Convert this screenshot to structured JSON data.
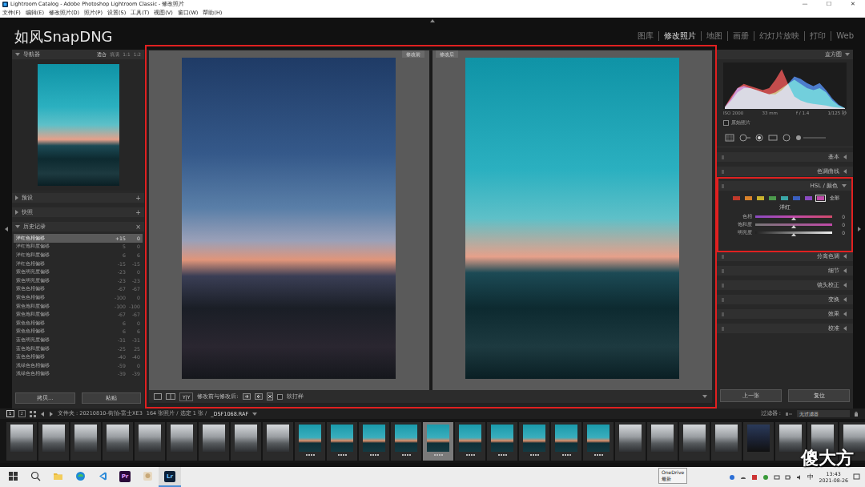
{
  "window": {
    "title": "Lightroom Catalog - Adobe Photoshop Lightroom Classic - 修改照片",
    "controls": [
      "—",
      "☐",
      "✕"
    ]
  },
  "menu": [
    "文件(F)",
    "编辑(E)",
    "修改照片(D)",
    "照片(P)",
    "设置(S)",
    "工具(T)",
    "视图(V)",
    "窗口(W)",
    "帮助(H)"
  ],
  "identity_plate": "如风SnapDNG",
  "modules": [
    {
      "label": "图库",
      "selected": false
    },
    {
      "label": "修改照片",
      "selected": true
    },
    {
      "label": "地图",
      "selected": false
    },
    {
      "label": "画册",
      "selected": false
    },
    {
      "label": "幻灯片放映",
      "selected": false
    },
    {
      "label": "打印",
      "selected": false
    },
    {
      "label": "Web",
      "selected": false
    }
  ],
  "left_panel": {
    "navigator": {
      "title": "导航器",
      "expanded": true,
      "zoom": [
        {
          "label": "适合",
          "selected": true
        },
        {
          "label": "填满",
          "selected": false
        },
        {
          "label": "1:1",
          "selected": false
        },
        {
          "label": "1:2",
          "selected": false
        }
      ]
    },
    "sections": [
      {
        "title": "预设",
        "action": "+",
        "expanded": false
      },
      {
        "title": "快照",
        "action": "+",
        "expanded": false
      },
      {
        "title": "历史记录",
        "action": "×",
        "expanded": true
      }
    ],
    "history": [
      {
        "name": "洋红色相偏移",
        "from": "+15",
        "to": "0",
        "selected": true
      },
      {
        "name": "洋红饱和度偏移",
        "from": "5",
        "to": "0",
        "selected": false
      },
      {
        "name": "洋红饱和度偏移",
        "from": "6",
        "to": "6",
        "selected": false
      },
      {
        "name": "洋红色相偏移",
        "from": "-15",
        "to": "-15",
        "selected": false
      },
      {
        "name": "紫色明亮度偏移",
        "from": "-23",
        "to": "0",
        "selected": false
      },
      {
        "name": "紫色明亮度偏移",
        "from": "-23",
        "to": "-23",
        "selected": false
      },
      {
        "name": "紫色色相偏移",
        "from": "-67",
        "to": "-67",
        "selected": false
      },
      {
        "name": "紫色色相偏移",
        "from": "-100",
        "to": "0",
        "selected": false
      },
      {
        "name": "紫色饱和度偏移",
        "from": "-100",
        "to": "-100",
        "selected": false
      },
      {
        "name": "紫色饱和度偏移",
        "from": "-67",
        "to": "-67",
        "selected": false
      },
      {
        "name": "紫色色相偏移",
        "from": "6",
        "to": "0",
        "selected": false
      },
      {
        "name": "紫色色相偏移",
        "from": "6",
        "to": "6",
        "selected": false
      },
      {
        "name": "蓝色明亮度偏移",
        "from": "-31",
        "to": "-31",
        "selected": false
      },
      {
        "name": "蓝色饱和度偏移",
        "from": "-25",
        "to": "25",
        "selected": false
      },
      {
        "name": "蓝色色相偏移",
        "from": "-40",
        "to": "-40",
        "selected": false
      },
      {
        "name": "浅绿色色相偏移",
        "from": "-59",
        "to": "0",
        "selected": false
      },
      {
        "name": "浅绿色色相偏移",
        "from": "-39",
        "to": "-39",
        "selected": false
      }
    ],
    "buttons": [
      "拷贝...",
      "粘贴"
    ]
  },
  "view": {
    "before": "修改前",
    "after": "修改后",
    "toolbar": {
      "mode": "Y|Y",
      "label": "修改前与修改后:",
      "soft_proof": {
        "label": "软打样",
        "checked": false
      }
    }
  },
  "right_panel": {
    "histogram": {
      "title": "直方图",
      "expanded": true,
      "series": {
        "red": [
          0.05,
          0.3,
          0.5,
          0.6,
          0.55,
          0.5,
          0.45,
          0.5,
          0.7,
          0.95,
          0.6,
          0.3,
          0.2,
          0.15,
          0.12,
          0.1,
          0.08,
          0.05,
          0.03,
          0.02
        ],
        "green": [
          0.04,
          0.2,
          0.4,
          0.5,
          0.5,
          0.45,
          0.4,
          0.35,
          0.4,
          0.5,
          0.6,
          0.7,
          0.6,
          0.5,
          0.45,
          0.5,
          0.4,
          0.2,
          0.08,
          0.02
        ],
        "blue": [
          0.05,
          0.25,
          0.5,
          0.55,
          0.5,
          0.45,
          0.4,
          0.35,
          0.35,
          0.45,
          0.6,
          0.78,
          0.72,
          0.62,
          0.55,
          0.62,
          0.45,
          0.25,
          0.1,
          0.02
        ]
      },
      "info": [
        "ISO 2000",
        "33 mm",
        "f / 1.4",
        "1/125 秒"
      ],
      "original_photo": {
        "label": "原始照片",
        "checked": false
      }
    },
    "sections": [
      {
        "title": "基本",
        "expanded": false
      },
      {
        "title": "色调曲线",
        "expanded": false
      },
      {
        "title": "HSL / 颜色",
        "expanded": true
      },
      {
        "title": "分离色调",
        "expanded": false
      },
      {
        "title": "细节",
        "expanded": false
      },
      {
        "title": "镜头校正",
        "expanded": false
      },
      {
        "title": "变换",
        "expanded": false
      },
      {
        "title": "效果",
        "expanded": false
      },
      {
        "title": "校准",
        "expanded": false
      }
    ],
    "hsl": {
      "swatches": [
        {
          "color": "#c0392b",
          "selected": false
        },
        {
          "color": "#d9822b",
          "selected": false
        },
        {
          "color": "#c9b22e",
          "selected": false
        },
        {
          "color": "#4c9a4c",
          "selected": false
        },
        {
          "color": "#3aa6a6",
          "selected": false
        },
        {
          "color": "#3a5fc0",
          "selected": false
        },
        {
          "color": "#8a4ac0",
          "selected": false
        },
        {
          "color": "#c04aa8",
          "selected": true
        }
      ],
      "all": "全部",
      "current": "洋红",
      "sliders": [
        {
          "label": "色相",
          "value": "0",
          "level": 0.5,
          "kind": "hue"
        },
        {
          "label": "饱和度",
          "value": "0",
          "level": 0.5,
          "kind": "saturation"
        },
        {
          "label": "明亮度",
          "value": "0",
          "level": 0.5,
          "kind": "luminance"
        }
      ]
    },
    "buttons": [
      "上一张",
      "复位"
    ]
  },
  "filmstrip": {
    "pages": [
      {
        "label": "1",
        "selected": true
      },
      {
        "label": "2",
        "selected": false
      }
    ],
    "source": "文件夹 : 20210810-街拍-富士XE3",
    "count": "164 张照片 / 选定 1 张 /",
    "file": "_DSF1068.RAF",
    "filter_label": "过滤器 :",
    "filter": "无过滤器",
    "thumbs": [
      {
        "kind": "street",
        "stars": 0,
        "selected": false
      },
      {
        "kind": "street",
        "stars": 0,
        "selected": false
      },
      {
        "kind": "street",
        "stars": 0,
        "selected": false
      },
      {
        "kind": "street",
        "stars": 0,
        "selected": false
      },
      {
        "kind": "street",
        "stars": 0,
        "selected": false
      },
      {
        "kind": "street",
        "stars": 0,
        "selected": false
      },
      {
        "kind": "street",
        "stars": 0,
        "selected": false
      },
      {
        "kind": "street",
        "stars": 0,
        "selected": false
      },
      {
        "kind": "street",
        "stars": 0,
        "selected": false
      },
      {
        "kind": "sky",
        "stars": 4,
        "selected": false
      },
      {
        "kind": "sky",
        "stars": 4,
        "selected": false
      },
      {
        "kind": "sky",
        "stars": 4,
        "selected": false
      },
      {
        "kind": "sky",
        "stars": 4,
        "selected": false
      },
      {
        "kind": "sky",
        "stars": 4,
        "selected": true
      },
      {
        "kind": "sky",
        "stars": 4,
        "selected": false
      },
      {
        "kind": "sky",
        "stars": 4,
        "selected": false
      },
      {
        "kind": "sky",
        "stars": 4,
        "selected": false
      },
      {
        "kind": "sky",
        "stars": 4,
        "selected": false
      },
      {
        "kind": "sky",
        "stars": 4,
        "selected": false
      },
      {
        "kind": "street",
        "stars": 0,
        "selected": false
      },
      {
        "kind": "street",
        "stars": 0,
        "selected": false
      },
      {
        "kind": "street",
        "stars": 0,
        "selected": false
      },
      {
        "kind": "street",
        "stars": 0,
        "selected": false
      },
      {
        "kind": "night",
        "stars": 0,
        "selected": false
      },
      {
        "kind": "street",
        "stars": 0,
        "selected": false
      },
      {
        "kind": "street",
        "stars": 0,
        "selected": false
      },
      {
        "kind": "street",
        "stars": 0,
        "selected": false
      }
    ]
  },
  "taskbar": {
    "apps": [
      {
        "kind": "start",
        "active": false
      },
      {
        "kind": "search",
        "active": false
      },
      {
        "kind": "folder",
        "active": false
      },
      {
        "kind": "edge",
        "active": false
      },
      {
        "kind": "code",
        "active": false
      },
      {
        "kind": "badge",
        "label": "Pr",
        "active": false
      },
      {
        "kind": "app",
        "active": false
      },
      {
        "kind": "badge",
        "label": "Lr",
        "active": true
      }
    ],
    "ime": "中",
    "time": "13:43",
    "date": "2021-08-26"
  },
  "tooltip": {
    "title": "OneDrive",
    "text": "最新"
  },
  "watermark": "傻大方"
}
